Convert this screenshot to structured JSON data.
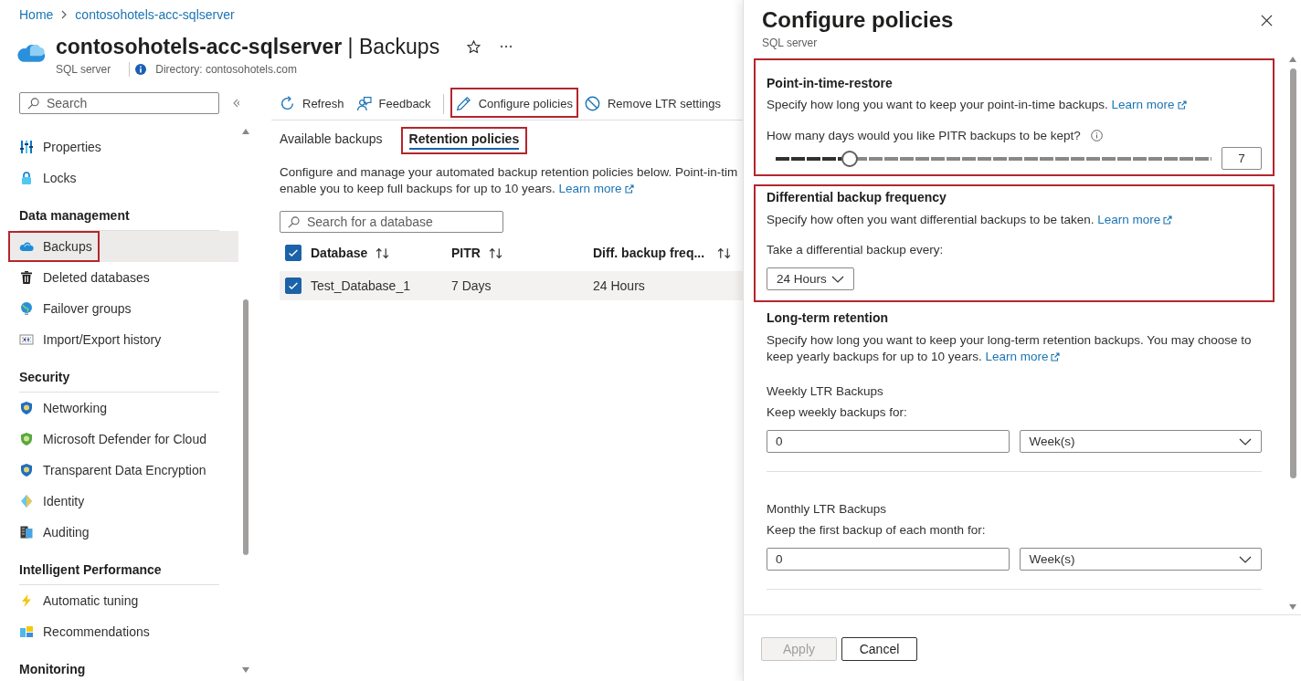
{
  "breadcrumb": [
    "Home",
    "contosohotels-acc-sqlserver"
  ],
  "header": {
    "title": "**contosohotels-acc-sqlserver** | Backups",
    "resource_type": "SQL server",
    "directory": "Directory: contosohotels.com"
  },
  "sidebar": {
    "search": {
      "placeholder": "Search"
    },
    "sections": [
      {
        "items": [
          {
            "label": "Properties",
            "selected": false,
            "highlighted": false
          },
          {
            "label": "Locks",
            "selected": false,
            "highlighted": false
          }
        ]
      },
      {
        "heading": "Data management",
        "items": [
          {
            "label": "Backups",
            "selected": true,
            "highlighted": true
          },
          {
            "label": "Deleted databases",
            "selected": false,
            "highlighted": false
          },
          {
            "label": "Failover groups",
            "selected": false,
            "highlighted": false
          },
          {
            "label": "Import/Export history",
            "selected": false,
            "highlighted": false
          }
        ]
      },
      {
        "heading": "Security",
        "items": [
          {
            "label": "Networking",
            "selected": false,
            "highlighted": false
          },
          {
            "label": "Microsoft Defender for Cloud",
            "selected": false,
            "highlighted": false
          },
          {
            "label": "Transparent Data Encryption",
            "selected": false,
            "highlighted": false
          },
          {
            "label": "Identity",
            "selected": false,
            "highlighted": false
          },
          {
            "label": "Auditing",
            "selected": false,
            "highlighted": false
          }
        ]
      },
      {
        "heading": "Intelligent Performance",
        "items": [
          {
            "label": "Automatic tuning",
            "selected": false,
            "highlighted": false
          },
          {
            "label": "Recommendations",
            "selected": false,
            "highlighted": false
          }
        ]
      },
      {
        "heading": "Monitoring"
      }
    ]
  },
  "toolbar": [
    [
      {
        "label": "Refresh",
        "highlighted": false
      },
      {
        "label": "Feedback",
        "highlighted": false
      }
    ],
    [
      {
        "label": "Configure policies",
        "highlighted": true
      },
      {
        "label": "Remove LTR settings",
        "highlighted": false
      }
    ]
  ],
  "tabs": [
    {
      "label": "Available backups",
      "selected": false,
      "highlighted": false
    },
    {
      "label": "Retention policies",
      "selected": true,
      "highlighted": true
    }
  ],
  "description": {
    "lines": [
      "Configure and manage your automated backup retention policies below. Point-in-tim",
      "enable you to keep full backups for up to 10 years."
    ],
    "link": "Learn more"
  },
  "table": {
    "search": {
      "placeholder": "Search for a database"
    },
    "select_all": {
      "checked": true
    },
    "columns": [
      {
        "label": "Database",
        "sortable": true
      },
      {
        "label": "PITR",
        "sortable": true
      },
      {
        "label": "Diff. backup freq...",
        "sortable": true
      }
    ],
    "rows": [
      {
        "selected": true,
        "cells": [
          "Test_Database_1",
          "7 Days",
          "24 Hours"
        ]
      }
    ]
  },
  "panel": {
    "title": "Configure policies",
    "subtitle": "SQL server",
    "sections": [
      {
        "kind": "slider",
        "highlighted": true,
        "heading": "Point-in-time-restore",
        "description": "Specify how long you want to keep your point-in-time backups.",
        "link": "Learn more",
        "question": "How many days would you like PITR backups to be kept?",
        "level": 0.17,
        "value": "7"
      },
      {
        "kind": "select",
        "highlighted": true,
        "heading": "Differential backup frequency",
        "description": "Specify how often you want differential backups to be taken.",
        "link": "Learn more",
        "label": "Take a differential backup every:",
        "value": "24 Hours"
      },
      {
        "kind": "ltr",
        "highlighted": false,
        "heading": "Long-term retention",
        "description": "Specify how long you want to keep your long-term retention backups. You may choose to keep yearly backups for up to 10 years.",
        "link": "Learn more",
        "groups": [
          {
            "title": "Weekly LTR Backups",
            "label": "Keep weekly backups for:",
            "value": "0",
            "unit": "Week(s)"
          },
          {
            "title": "Monthly LTR Backups",
            "label": "Keep the first backup of each month for:",
            "value": "0",
            "unit": "Week(s)"
          }
        ]
      }
    ],
    "buttons": [
      {
        "label": "Apply",
        "disabled": true
      },
      {
        "label": "Cancel",
        "disabled": false
      }
    ]
  }
}
